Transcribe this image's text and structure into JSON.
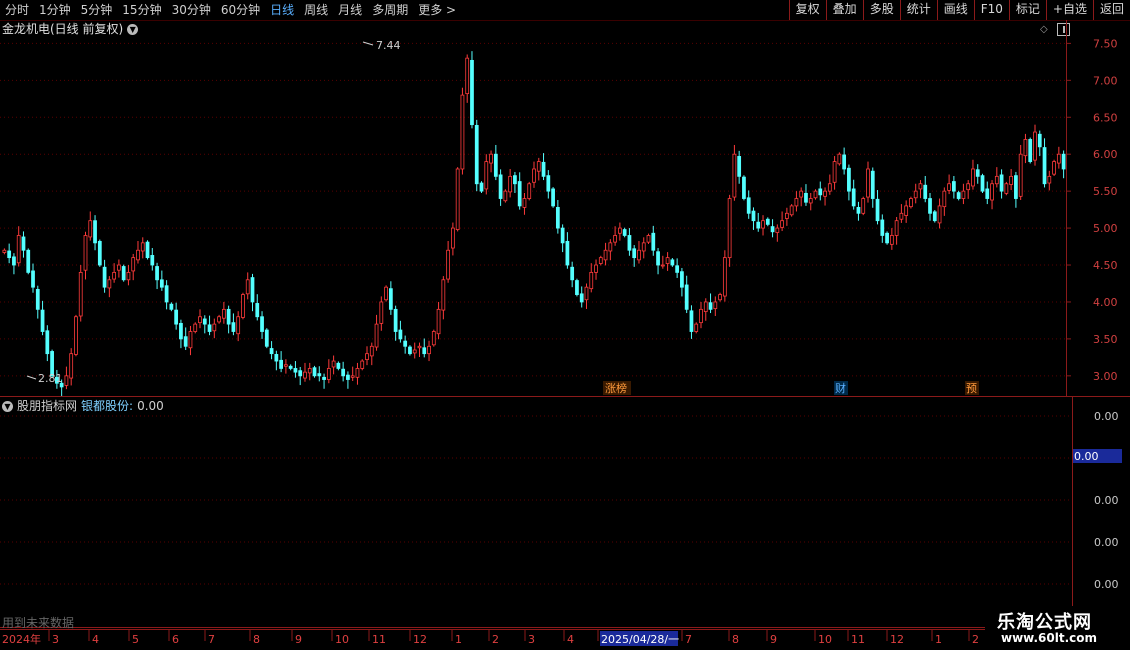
{
  "toolbar": {
    "periods": [
      "分时",
      "1分钟",
      "5分钟",
      "15分钟",
      "30分钟",
      "60分钟",
      "日线",
      "周线",
      "月线",
      "多周期",
      "更多 >"
    ],
    "active_period": "日线",
    "buttons": [
      "复权",
      "叠加",
      "多股",
      "统计",
      "画线",
      "F10",
      "标记",
      "+自选",
      "返回"
    ]
  },
  "chart": {
    "title": "金龙机电(日线 前复权)",
    "high_label": "7.44",
    "low_label": "2.81",
    "events": [
      "涨榜",
      "财",
      "预"
    ],
    "y_ticks": [
      "7.50",
      "7.00",
      "6.50",
      "6.00",
      "5.50",
      "5.00",
      "4.50",
      "4.00",
      "3.50",
      "3.00"
    ]
  },
  "indicator": {
    "name": "股朋指标网",
    "sub_label": "银都股份:",
    "value": "0.00",
    "y_ticks": [
      "0.00",
      "0.00",
      "0.00",
      "0.00",
      "0.00"
    ],
    "highlight": "0.00"
  },
  "footer": {
    "future_note": "用到未来数据",
    "year_label": "2024年",
    "months": [
      "3",
      "4",
      "5",
      "6",
      "7",
      "8",
      "9",
      "10",
      "11",
      "12",
      "1",
      "2",
      "3",
      "4",
      "2025/04/28/一",
      "7",
      "8",
      "9",
      "10",
      "11",
      "12",
      "1",
      "2"
    ]
  },
  "brand": {
    "name": "乐淘公式网",
    "url": "www.60lt.com"
  },
  "colors": {
    "up": "#ff3b3b",
    "down": "#54ffff",
    "grid": "#7a0000",
    "axis": "#8b1a1a",
    "accent": "#5ab0ff"
  },
  "chart_data": {
    "type": "candlestick",
    "title": "金龙机电(日线 前复权)",
    "ylim": [
      2.7,
      7.6
    ],
    "annotated_high": 7.44,
    "annotated_low": 2.81,
    "close_series": [
      4.7,
      4.6,
      4.5,
      4.9,
      4.7,
      4.4,
      4.2,
      3.9,
      3.6,
      3.3,
      3.0,
      2.9,
      2.85,
      3.0,
      3.3,
      3.8,
      4.4,
      4.9,
      5.1,
      4.8,
      4.5,
      4.2,
      4.3,
      4.4,
      4.5,
      4.3,
      4.4,
      4.6,
      4.7,
      4.8,
      4.6,
      4.5,
      4.3,
      4.2,
      4.0,
      3.9,
      3.7,
      3.5,
      3.4,
      3.6,
      3.7,
      3.8,
      3.7,
      3.6,
      3.7,
      3.8,
      3.9,
      3.7,
      3.6,
      3.8,
      4.1,
      4.3,
      4.0,
      3.8,
      3.6,
      3.4,
      3.3,
      3.2,
      3.1,
      3.15,
      3.1,
      3.05,
      3.0,
      3.05,
      3.1,
      3.0,
      3.0,
      2.95,
      3.1,
      3.2,
      3.1,
      3.0,
      2.95,
      3.0,
      3.1,
      3.2,
      3.3,
      3.4,
      3.7,
      4.0,
      4.2,
      3.9,
      3.6,
      3.5,
      3.4,
      3.3,
      3.35,
      3.4,
      3.3,
      3.4,
      3.6,
      3.9,
      4.3,
      4.7,
      5.0,
      5.8,
      6.8,
      7.3,
      6.4,
      5.6,
      5.5,
      5.9,
      6.0,
      5.7,
      5.4,
      5.5,
      5.7,
      5.6,
      5.3,
      5.4,
      5.6,
      5.8,
      5.9,
      5.7,
      5.5,
      5.3,
      5.0,
      4.8,
      4.5,
      4.3,
      4.1,
      4.0,
      4.2,
      4.4,
      4.5,
      4.6,
      4.7,
      4.8,
      4.9,
      5.0,
      4.9,
      4.7,
      4.6,
      4.7,
      4.8,
      4.9,
      4.7,
      4.5,
      4.5,
      4.6,
      4.5,
      4.4,
      4.2,
      3.9,
      3.6,
      3.7,
      3.9,
      4.0,
      3.9,
      4.0,
      4.1,
      4.6,
      5.4,
      6.0,
      5.7,
      5.4,
      5.2,
      5.1,
      5.0,
      5.1,
      5.05,
      4.95,
      5.0,
      5.1,
      5.2,
      5.3,
      5.4,
      5.5,
      5.35,
      5.4,
      5.5,
      5.45,
      5.5,
      5.6,
      5.9,
      6.0,
      5.8,
      5.5,
      5.3,
      5.2,
      5.4,
      5.8,
      5.4,
      5.1,
      4.9,
      4.8,
      4.9,
      5.1,
      5.2,
      5.3,
      5.4,
      5.5,
      5.6,
      5.4,
      5.2,
      5.1,
      5.3,
      5.5,
      5.6,
      5.5,
      5.4,
      5.5,
      5.6,
      5.8,
      5.7,
      5.5,
      5.4,
      5.6,
      5.7,
      5.5,
      5.6,
      5.7,
      5.4,
      6.0,
      6.2,
      5.9,
      6.3,
      6.1,
      5.6,
      5.7,
      5.9,
      6.0,
      5.8
    ]
  }
}
